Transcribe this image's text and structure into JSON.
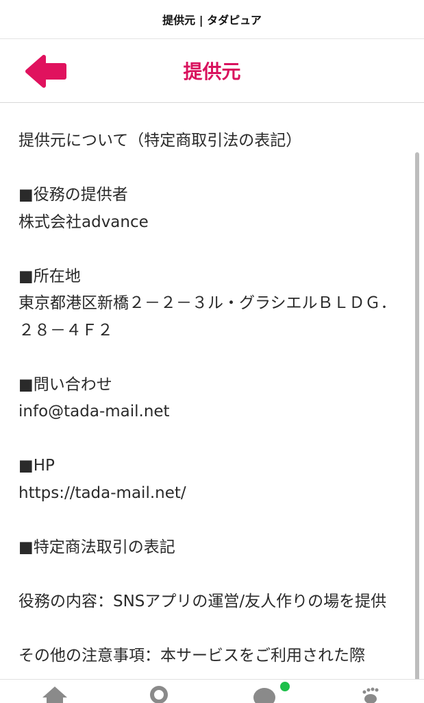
{
  "browser": {
    "tab_title": "提供元 | タダピュア"
  },
  "header": {
    "back_icon": "back-arrow-icon",
    "title": "提供元"
  },
  "content": {
    "intro": "提供元について（特定商取引法の表記）",
    "provider_heading": "■役務の提供者",
    "provider_value": "株式会社advance",
    "address_heading": "■所在地",
    "address_value": "東京都港区新橋２－２－３ル・グラシエルＢＬＤＧ．２８－４Ｆ２",
    "contact_heading": "■問い合わせ",
    "contact_value": "info@tada-mail.net",
    "hp_heading": "■HP",
    "hp_value": "https://tada-mail.net/",
    "law_heading": "■特定商法取引の表記",
    "service_content": "役務の内容：SNSアプリの運営/友人作りの場を提供",
    "other_notes": "その他の注意事項：本サービスをご利用された際"
  },
  "tabbar": {
    "items": [
      "home-icon",
      "search-icon",
      "chat-icon",
      "footprints-icon"
    ],
    "badge_color": "#1dbf4a"
  },
  "colors": {
    "accent": "#d9125e",
    "text": "#2a2a2a"
  }
}
